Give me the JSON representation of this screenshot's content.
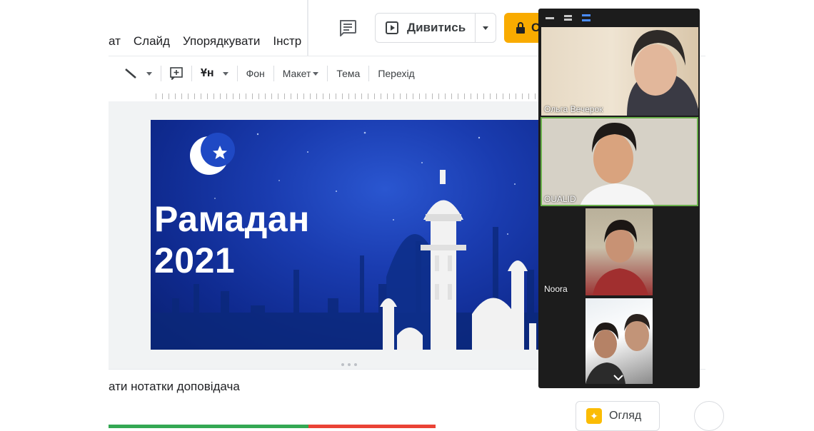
{
  "menubar": {
    "items": [
      "ат",
      "Слайд",
      "Упорядкувати",
      "Інстр"
    ]
  },
  "header": {
    "present_label": "Дивитись",
    "share_label": "С"
  },
  "toolbar": {
    "text_style_label": "Ұн",
    "background_label": "Фон",
    "layout_label": "Макет",
    "theme_label": "Тема",
    "transition_label": "Перехід"
  },
  "slide": {
    "title_line1": "Рамадан",
    "title_line2": "2021"
  },
  "notes": {
    "placeholder": "ати нотатки доповідача"
  },
  "review": {
    "label": "Огляд"
  },
  "video_panel": {
    "participants": [
      {
        "name": "Ольга Вечерок"
      },
      {
        "name": "OUALID"
      },
      {
        "name": "Noora"
      },
      {
        "name": ""
      }
    ]
  },
  "colors": {
    "share_button": "#f9ab00",
    "progress_green": "#34a853",
    "progress_red": "#ea4335",
    "active_speaker_border": "#6ab04c"
  }
}
